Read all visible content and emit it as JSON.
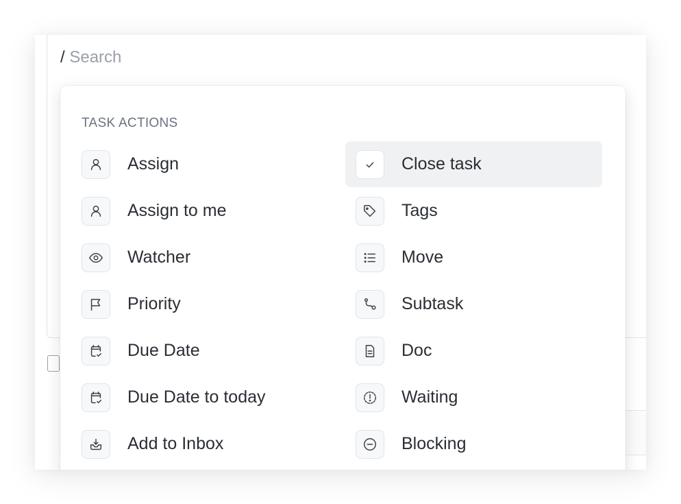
{
  "search": {
    "prefix": "/",
    "placeholder": "Search"
  },
  "menu": {
    "section_title": "TASK ACTIONS",
    "left_items": [
      {
        "label": "Assign",
        "icon": "user-icon"
      },
      {
        "label": "Assign to me",
        "icon": "user-icon"
      },
      {
        "label": "Watcher",
        "icon": "eye-icon"
      },
      {
        "label": "Priority",
        "icon": "flag-icon"
      },
      {
        "label": "Due Date",
        "icon": "calendar-check-icon"
      },
      {
        "label": "Due Date to today",
        "icon": "calendar-check-icon"
      },
      {
        "label": "Add to Inbox",
        "icon": "inbox-icon"
      }
    ],
    "right_items": [
      {
        "label": "Close task",
        "icon": "check-icon",
        "active": true
      },
      {
        "label": "Tags",
        "icon": "tag-icon"
      },
      {
        "label": "Move",
        "icon": "list-icon"
      },
      {
        "label": "Subtask",
        "icon": "subtask-icon"
      },
      {
        "label": "Doc",
        "icon": "document-icon"
      },
      {
        "label": "Waiting",
        "icon": "alert-circle-icon"
      },
      {
        "label": "Blocking",
        "icon": "minus-circle-icon"
      }
    ]
  },
  "colors": {
    "active_bg": "#f0f1f3",
    "text": "#2a2e34",
    "muted": "#6b7280"
  }
}
